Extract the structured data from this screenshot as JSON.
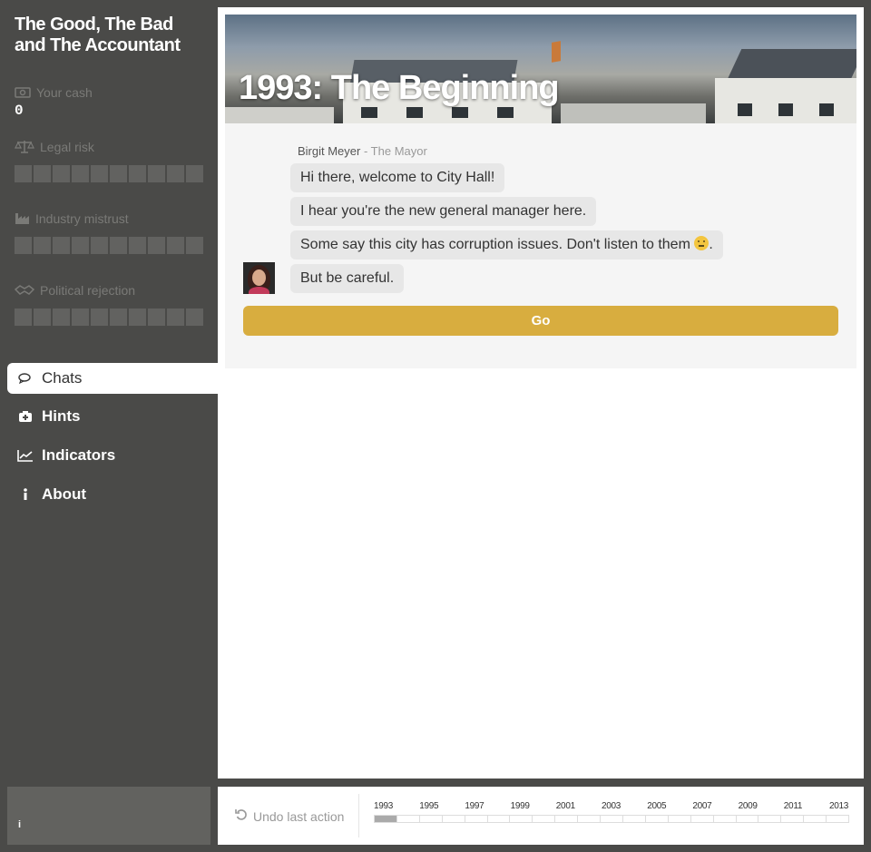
{
  "app": {
    "title_line1": "The Good, The Bad",
    "title_line2": "and The Accountant"
  },
  "stats": {
    "cash": {
      "label": "Your cash",
      "value": "0",
      "icon": "money-icon"
    },
    "legal_risk": {
      "label": "Legal risk",
      "icon": "scales-icon",
      "level": 0,
      "max": 10
    },
    "industry_mistrust": {
      "label": "Industry mistrust",
      "icon": "factory-icon",
      "level": 0,
      "max": 10
    },
    "political_rejection": {
      "label": "Political rejection",
      "icon": "handshake-icon",
      "level": 0,
      "max": 10
    }
  },
  "nav": {
    "items": [
      {
        "label": "Chats",
        "icon": "chat-icon",
        "active": true
      },
      {
        "label": "Hints",
        "icon": "hint-icon",
        "active": false
      },
      {
        "label": "Indicators",
        "icon": "chart-icon",
        "active": false
      },
      {
        "label": "About",
        "icon": "info-icon",
        "active": false
      }
    ]
  },
  "footer": {
    "info_glyph": "i"
  },
  "chapter": {
    "title": "1993: The Beginning"
  },
  "chat": {
    "speaker_name": "Birgit Meyer",
    "speaker_role": " - The Mayor",
    "messages": [
      "Hi there, welcome to City Hall!",
      "I hear you're the new general manager here.",
      "Some say this city has corruption issues. Don't listen to them",
      "But be careful."
    ],
    "message3_suffix": ".",
    "go_label": "Go"
  },
  "bottom": {
    "undo_label": "Undo last action",
    "years": [
      "1993",
      "1995",
      "1997",
      "1999",
      "2001",
      "2003",
      "2005",
      "2007",
      "2009",
      "2011",
      "2013"
    ],
    "progress_years_total": 21,
    "progress_years_done": 1
  },
  "colors": {
    "sidebar": "#4a4a48",
    "accent_button": "#d8ad3f",
    "bubble": "#e7e7e7",
    "panel": "#f5f5f5"
  }
}
